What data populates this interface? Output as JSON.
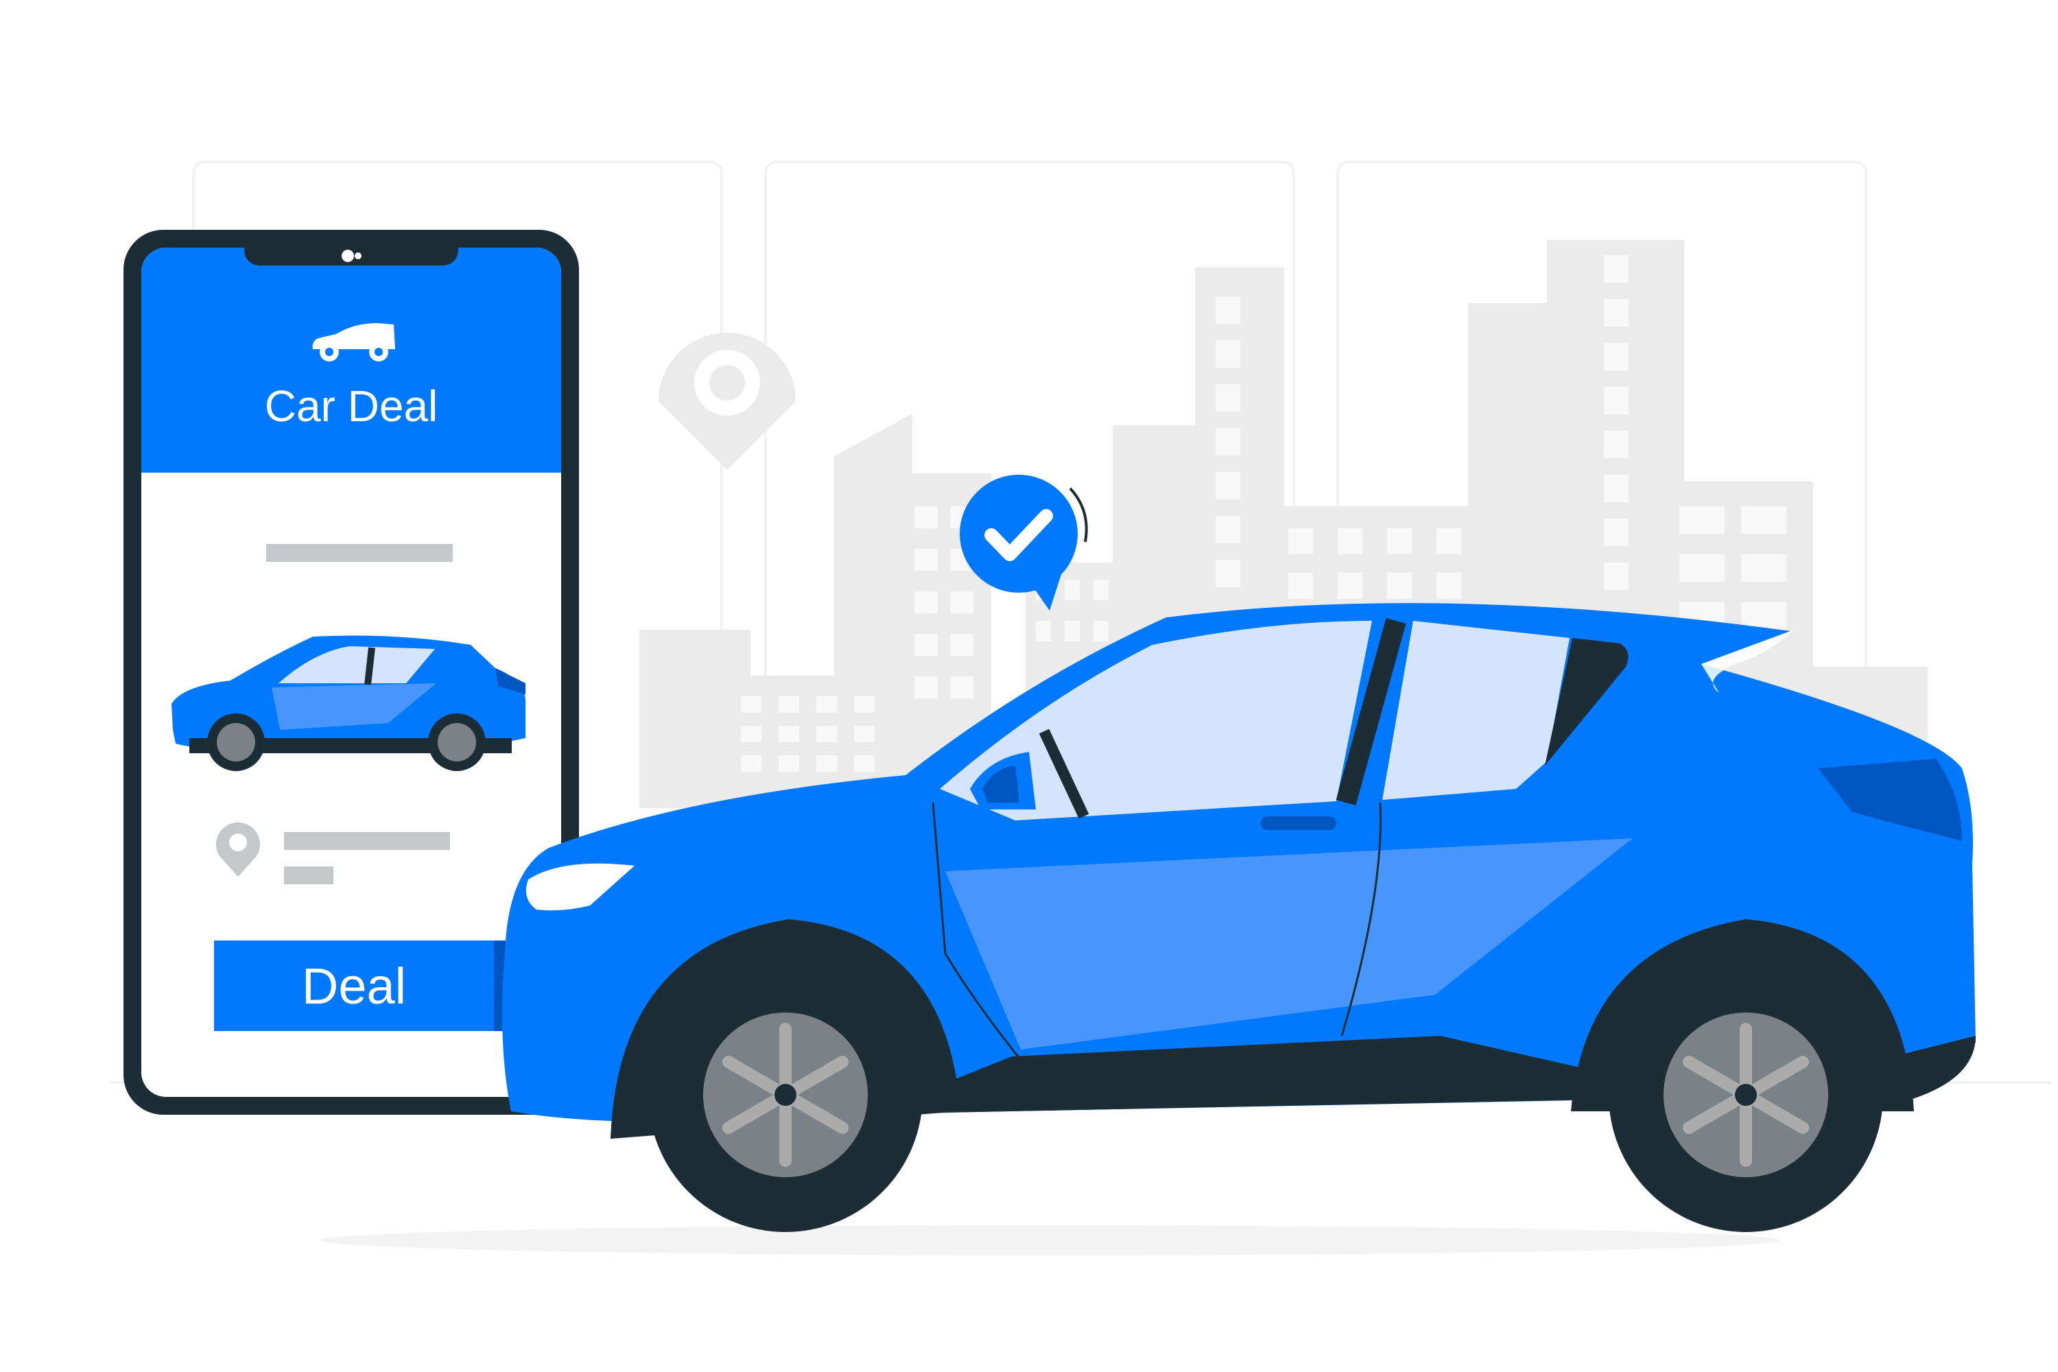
{
  "app": {
    "title": "Car Deal",
    "deal_button_label": "Deal"
  },
  "icons": {
    "header": "car-icon",
    "location": "location-pin-icon",
    "confirmation": "checkmark-badge-icon"
  },
  "colors": {
    "brand_blue": "#0079fe",
    "dark_blue": "#0056c0",
    "light_blue": "#4896fc",
    "window_blue": "#d4e4fc",
    "dark": "#1d2d35",
    "placeholder_gray": "#c5c8cb",
    "building_gray": "#ebebeb",
    "window_white": "#f5f5f5",
    "wheel_gray": "#7a8288"
  }
}
